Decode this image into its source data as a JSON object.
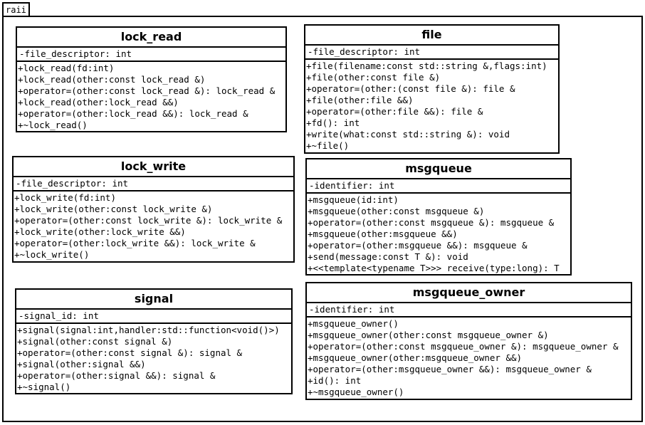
{
  "package": {
    "name": "raii"
  },
  "classes": {
    "lock_read": {
      "name": "lock_read",
      "attributes": [
        "-file_descriptor: int"
      ],
      "operations": [
        "+lock_read(fd:int)",
        "+lock_read(other:const lock_read &)",
        "+operator=(other:const lock_read &): lock_read &",
        "+lock_read(other:lock_read &&)",
        "+operator=(other:lock_read &&): lock_read &",
        "+~lock_read()"
      ]
    },
    "file": {
      "name": "file",
      "attributes": [
        "-file_descriptor: int"
      ],
      "operations": [
        "+file(filename:const std::string &,flags:int)",
        "+file(other:const file &)",
        "+operator=(other:(const file &): file &",
        "+file(other:file &&)",
        "+operator=(other:file &&): file &",
        "+fd(): int",
        "+write(what:const std::string &): void",
        "+~file()"
      ]
    },
    "lock_write": {
      "name": "lock_write",
      "attributes": [
        "-file_descriptor: int"
      ],
      "operations": [
        "+lock_write(fd:int)",
        "+lock_write(other:const lock_write &)",
        "+operator=(other:const lock_write &): lock_write &",
        "+lock_write(other:lock_write &&)",
        "+operator=(other:lock_write &&): lock_write &",
        "+~lock_write()"
      ]
    },
    "msgqueue": {
      "name": "msgqueue",
      "attributes": [
        "-identifier: int"
      ],
      "operations": [
        "+msgqueue(id:int)",
        "+msgqueue(other:const msgqueue &)",
        "+operator=(other:const msgqueue &): msgqueue &",
        "+msgqueue(other:msgqueue &&)",
        "+operator=(other:msgqueue &&): msgqueue &",
        "+send(message:const T &): void",
        "+<<template<typename T>>> receive(type:long): T"
      ]
    },
    "signal": {
      "name": "signal",
      "attributes": [
        "-signal_id: int"
      ],
      "operations": [
        "+signal(signal:int,handler:std::function<void()>)",
        "+signal(other:const signal &)",
        "+operator=(other:const signal &): signal &",
        "+signal(other:signal &&)",
        "+operator=(other:signal &&): signal &",
        "+~signal()"
      ]
    },
    "msgqueue_owner": {
      "name": "msgqueue_owner",
      "attributes": [
        "-identifier: int"
      ],
      "operations": [
        "+msgqueue_owner()",
        "+msgqueue_owner(other:const msgqueue_owner &)",
        "+operator=(other:const msgqueue_owner &): msgqueue_owner &",
        "+msgqueue_owner(other:msgqueue_owner &&)",
        "+operator=(other:msgqueue_owner &&): msgqueue_owner &",
        "+id(): int",
        "+~msgqueue_owner()"
      ]
    }
  }
}
